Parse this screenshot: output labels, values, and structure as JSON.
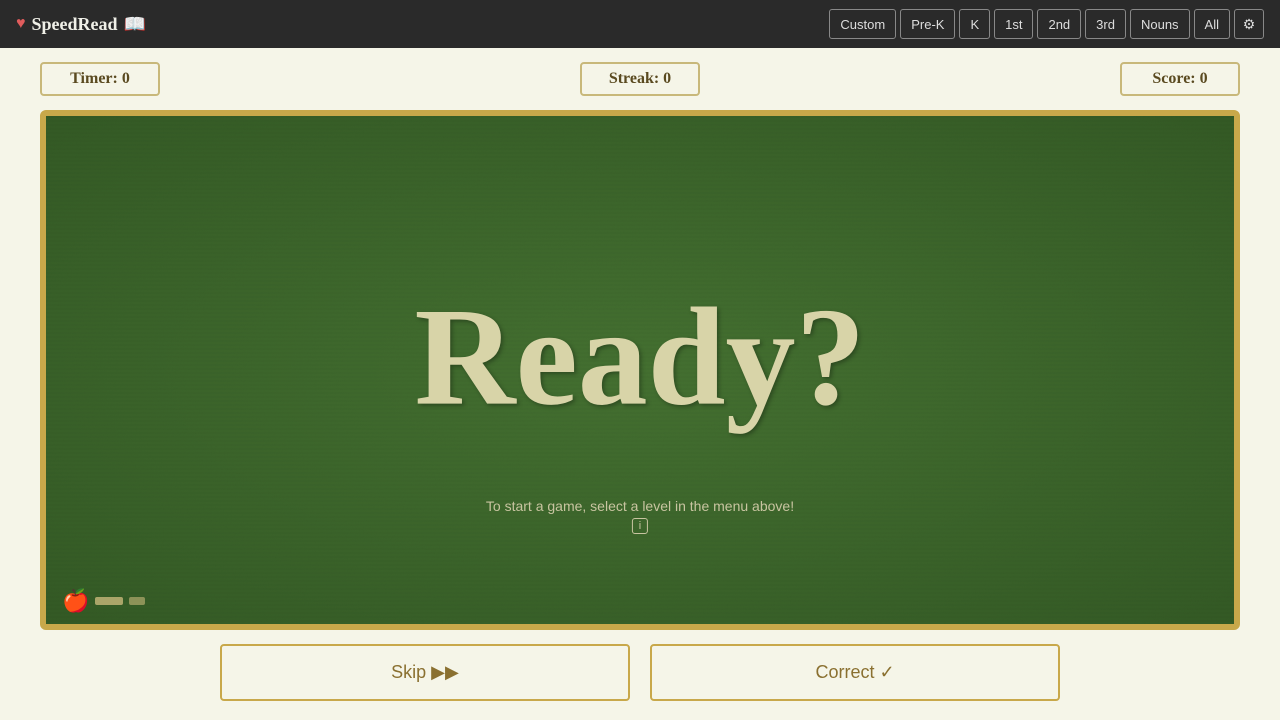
{
  "app": {
    "title": "SpeedRead",
    "heart": "♥",
    "books": "📖"
  },
  "nav": {
    "levels": [
      {
        "id": "custom",
        "label": "Custom",
        "active": false
      },
      {
        "id": "prek",
        "label": "Pre-K",
        "active": false
      },
      {
        "id": "k",
        "label": "K",
        "active": false
      },
      {
        "id": "first",
        "label": "1st",
        "active": false
      },
      {
        "id": "second",
        "label": "2nd",
        "active": false
      },
      {
        "id": "third",
        "label": "3rd",
        "active": false
      },
      {
        "id": "nouns",
        "label": "Nouns",
        "active": false
      },
      {
        "id": "all",
        "label": "All",
        "active": false
      }
    ],
    "settings_icon": "⚙"
  },
  "stats": {
    "timer_label": "Timer: 0",
    "streak_label": "Streak: 0",
    "score_label": "Score: 0"
  },
  "chalkboard": {
    "main_text": "Ready?",
    "hint_text": "To start a game, select a level in the menu above!",
    "info_icon": "i"
  },
  "actions": {
    "skip_label": "Skip ▶▶",
    "correct_label": "Correct ✓"
  }
}
